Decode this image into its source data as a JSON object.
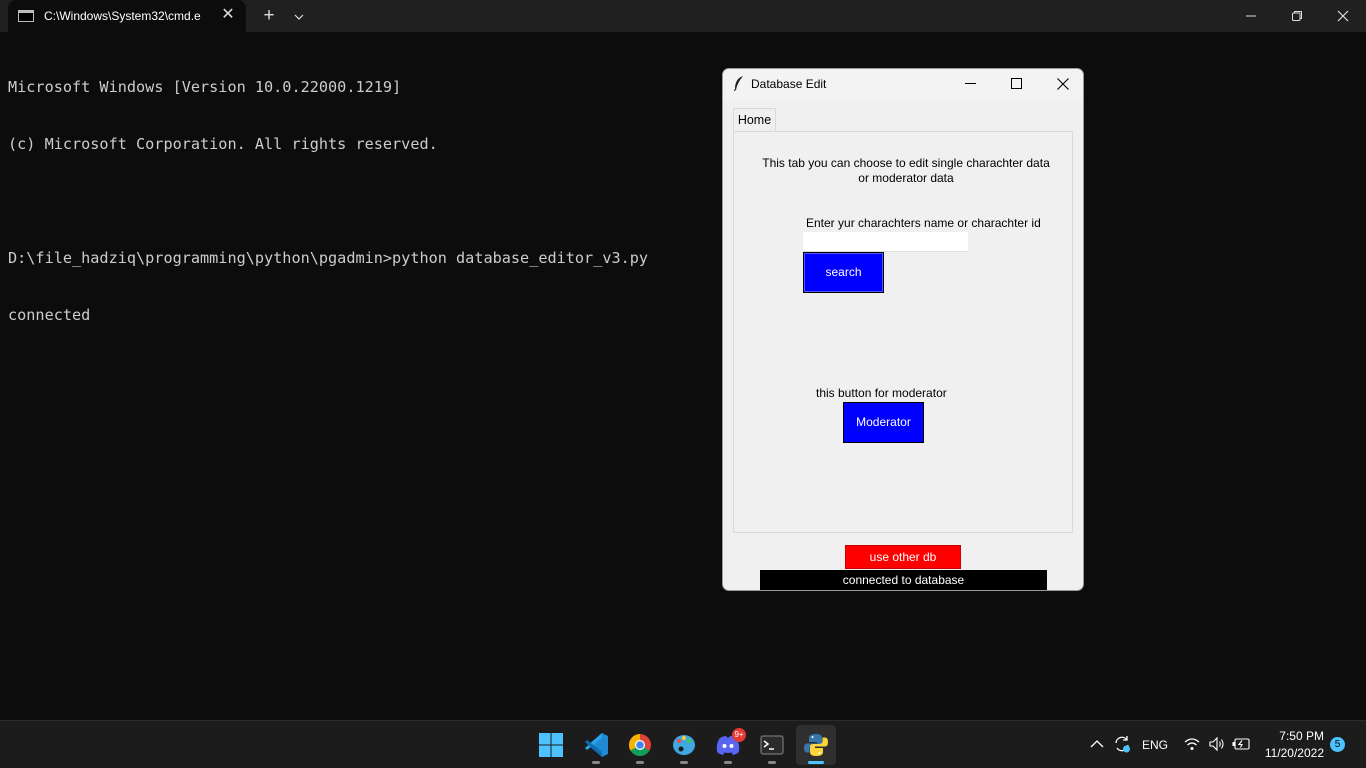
{
  "terminal": {
    "tab_title": "C:\\Windows\\System32\\cmd.e",
    "lines": [
      "Microsoft Windows [Version 10.0.22000.1219]",
      "(c) Microsoft Corporation. All rights reserved.",
      "",
      "D:\\file_hadziq\\programming\\python\\pgadmin>python database_editor_v3.py",
      "connected"
    ]
  },
  "app": {
    "title": "Database Edit",
    "tab_label": "Home",
    "description": "This tab you can choose to edit single charachter data or moderator data",
    "search_label": "Enter yur charachters name or charachter id",
    "search_value": "",
    "search_button": "search",
    "moderator_label": "this button for moderator",
    "moderator_button": "Moderator",
    "other_db_button": "use other db",
    "status": "connected to database",
    "colors": {
      "action_button": "#0000ff",
      "danger_button": "#ff0000",
      "status_bar": "#000000"
    }
  },
  "taskbar": {
    "apps": [
      {
        "name": "start",
        "icon": "windows-logo-icon"
      },
      {
        "name": "vscode",
        "icon": "vscode-icon"
      },
      {
        "name": "chrome",
        "icon": "chrome-icon"
      },
      {
        "name": "paint",
        "icon": "palette-icon"
      },
      {
        "name": "discord",
        "icon": "discord-icon",
        "badge": "9+"
      },
      {
        "name": "terminal",
        "icon": "terminal-icon"
      },
      {
        "name": "python",
        "icon": "python-icon",
        "active": true
      }
    ],
    "language": "ENG",
    "time": "7:50 PM",
    "date": "11/20/2022",
    "notification_count": "5"
  }
}
